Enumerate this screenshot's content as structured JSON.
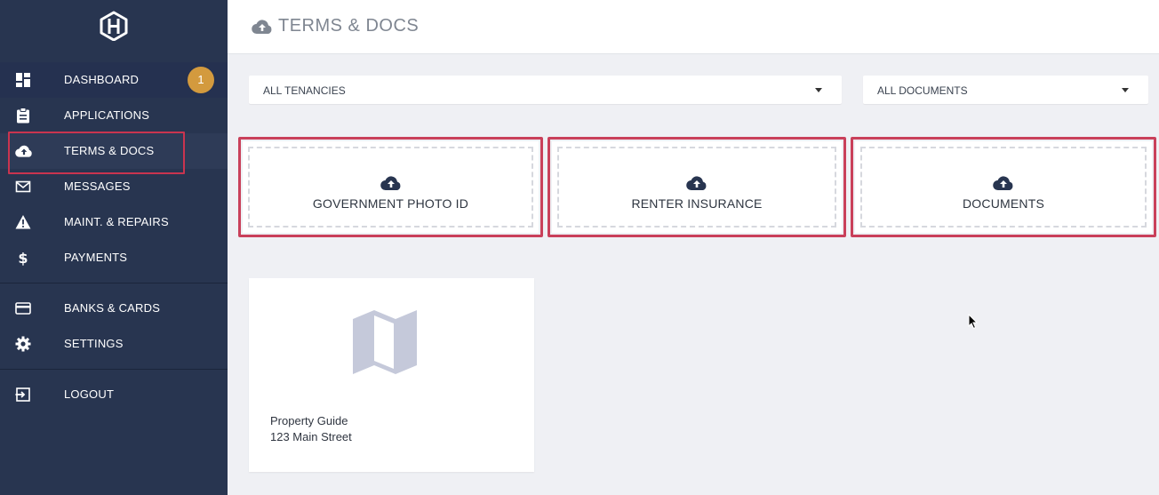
{
  "sidebar": {
    "logo_icon": "hexagon-h-logo",
    "items": [
      {
        "label": "DASHBOARD",
        "icon": "dashboard-icon",
        "badge": "1"
      },
      {
        "label": "APPLICATIONS",
        "icon": "clipboard-icon"
      },
      {
        "label": "TERMS & DOCS",
        "icon": "cloud-upload-icon",
        "active": true
      },
      {
        "label": "MESSAGES",
        "icon": "mail-icon"
      },
      {
        "label": "MAINT. & REPAIRS",
        "icon": "warning-icon"
      },
      {
        "label": "PAYMENTS",
        "icon": "dollar-icon"
      },
      {
        "label": "BANKS & CARDS",
        "icon": "credit-card-icon"
      },
      {
        "label": "SETTINGS",
        "icon": "gear-icon"
      },
      {
        "label": "LOGOUT",
        "icon": "logout-icon"
      }
    ]
  },
  "header": {
    "title": "TERMS & DOCS",
    "icon": "cloud-upload-icon"
  },
  "filters": {
    "tenancy": "ALL TENANCIES",
    "documents": "ALL DOCUMENTS"
  },
  "uploads": [
    {
      "label": "GOVERNMENT PHOTO ID",
      "icon": "cloud-upload-icon"
    },
    {
      "label": "RENTER INSURANCE",
      "icon": "cloud-upload-icon"
    },
    {
      "label": "DOCUMENTS",
      "icon": "cloud-upload-icon"
    }
  ],
  "property_card": {
    "name": "Property Guide",
    "address": "123 Main Street",
    "icon": "map-icon"
  },
  "colors": {
    "sidebar_bg": "#283550",
    "accent_badge": "#d39a3e",
    "highlight_border": "#c9344f",
    "page_bg": "#eff0f4"
  }
}
